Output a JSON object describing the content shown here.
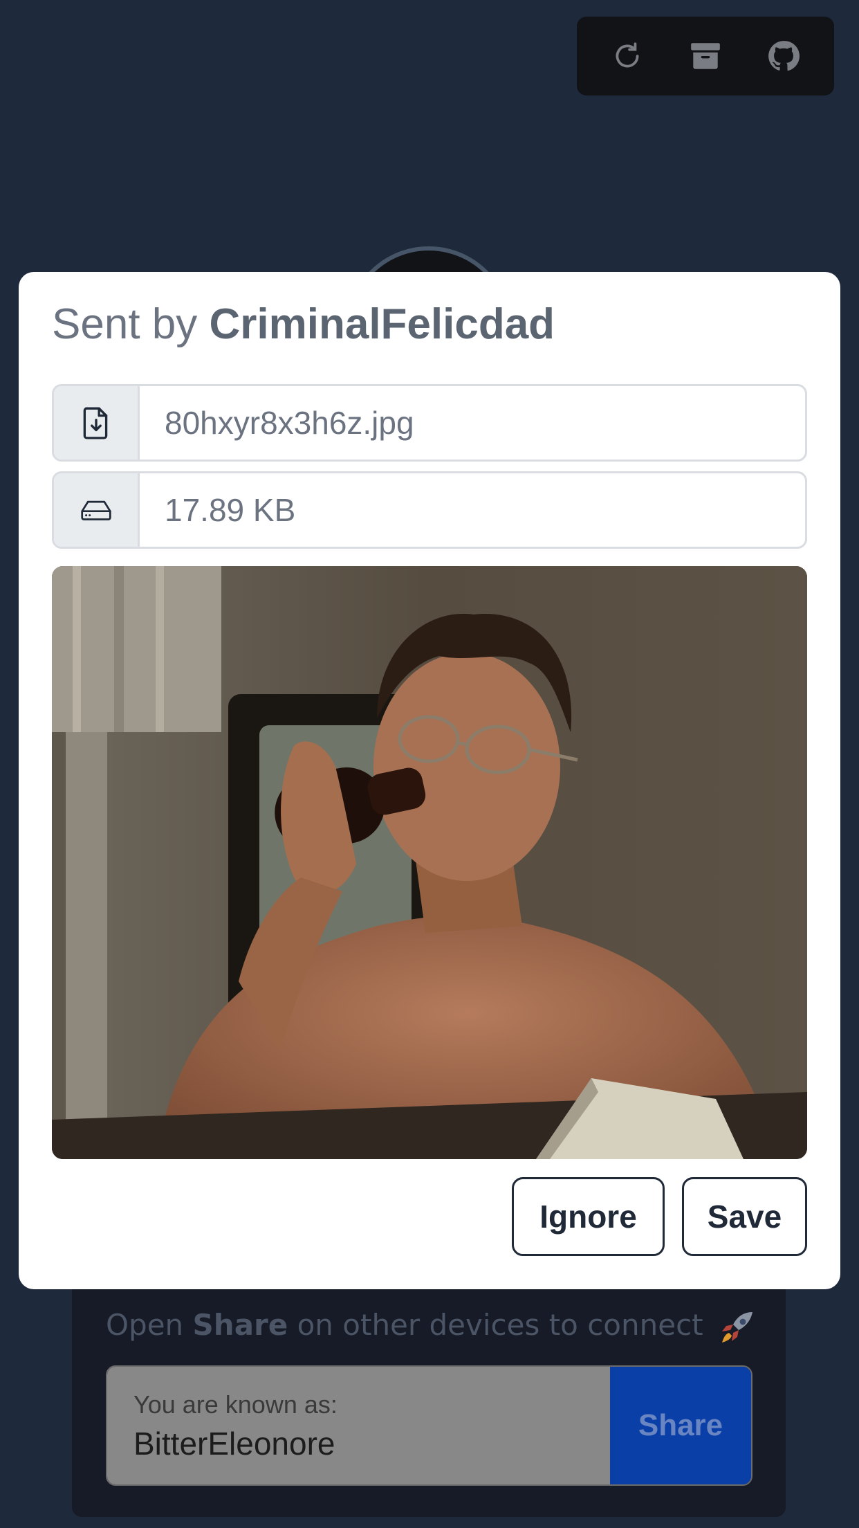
{
  "toolbar": {
    "buttons": [
      {
        "icon": "refresh-icon"
      },
      {
        "icon": "archive-icon"
      },
      {
        "icon": "github-icon"
      }
    ]
  },
  "dialog": {
    "title_prefix": "Sent by",
    "sender": "CriminalFelicdad",
    "file_name": "80hxyr8x3h6z.jpg",
    "file_size": "17.89 KB",
    "file_icon": "file-download-icon",
    "size_icon": "hard-drive-icon",
    "ignore_label": "Ignore",
    "save_label": "Save"
  },
  "background": {
    "hint_prefix": "Open",
    "hint_app": "Share",
    "hint_suffix": "on other devices to connect",
    "hint_icon": "rocket-icon",
    "known_label": "You are known as:",
    "known_name": "BitterEleonore",
    "share_label": "Share"
  },
  "colors": {
    "page_bg": "#1e293b",
    "dialog_bg": "#ffffff",
    "share_button": "#0a3fa8"
  }
}
